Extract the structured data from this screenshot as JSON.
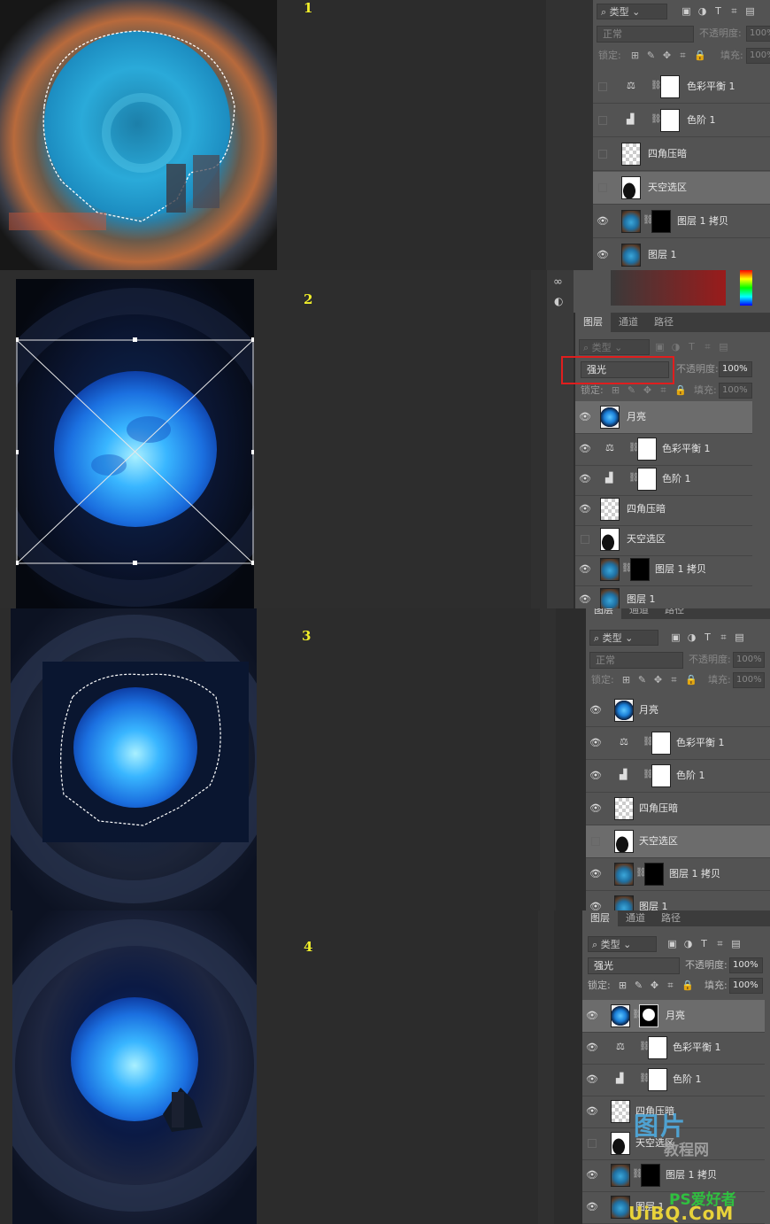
{
  "steps": [
    {
      "number": "1"
    },
    {
      "number": "2"
    },
    {
      "number": "3"
    },
    {
      "number": "4"
    }
  ],
  "panel_tabs": [
    "图层",
    "通道",
    "路径"
  ],
  "filter": {
    "kind_label": "类型"
  },
  "blend_modes": {
    "normal": "正常",
    "hard_light": "强光"
  },
  "labels": {
    "opacity": "不透明度:",
    "lock": "锁定:",
    "fill": "填充:"
  },
  "values": {
    "opacity": "100%",
    "fill": "100%"
  },
  "layers": {
    "moon": "月亮",
    "color_balance": "色彩平衡 1",
    "levels": "色阶 1",
    "vignette": "四角压暗",
    "sky_selection": "天空选区",
    "layer1_copy": "图层 1 拷贝",
    "layer1": "图层 1"
  },
  "icons": {
    "filter_icons": [
      "image-filter-icon",
      "adjustment-filter-icon",
      "type-filter-icon",
      "shape-filter-icon",
      "smart-object-filter-icon"
    ],
    "lock_icons": [
      "lock-transparent-icon",
      "lock-paint-icon",
      "lock-move-icon",
      "lock-artboard-icon",
      "lock-all-icon"
    ],
    "eye": "eye-icon",
    "link": "link-icon",
    "color_balance_adj": "scale-icon",
    "levels_adj": "histogram-icon"
  },
  "colors": {
    "panel_bg": "#535353",
    "highlight_box": "#e01e1e",
    "step_number": "#f0ee2a",
    "selected_row": "#6c6c6c"
  },
  "watermark": {
    "lines": [
      "图片",
      "教程网",
      "PS爱好者",
      "UiBQ.CoM"
    ]
  }
}
